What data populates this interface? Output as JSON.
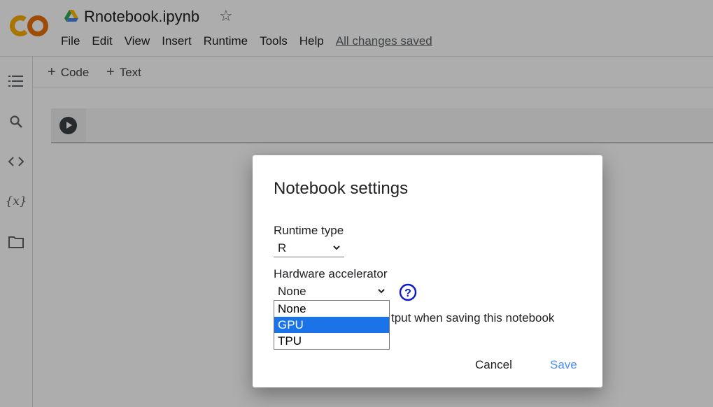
{
  "header": {
    "logo_text": "CO",
    "title": "Rnotebook.ipynb",
    "menu": [
      "File",
      "Edit",
      "View",
      "Insert",
      "Runtime",
      "Tools",
      "Help"
    ],
    "save_status": "All changes saved"
  },
  "sidebar": {
    "items": [
      {
        "icon": "table-of-contents-icon"
      },
      {
        "icon": "search-icon"
      },
      {
        "icon": "code-snippets-icon"
      },
      {
        "icon": "variables-icon",
        "label": "{x}"
      },
      {
        "icon": "files-folder-icon"
      }
    ]
  },
  "toolbar": {
    "add_code": "Code",
    "add_text": "Text"
  },
  "dialog": {
    "title": "Notebook settings",
    "runtime_type_label": "Runtime type",
    "runtime_type_value": "R",
    "hardware_label": "Hardware accelerator",
    "hardware_value": "None",
    "hardware_options": [
      "None",
      "GPU",
      "TPU"
    ],
    "highlighted_option": "GPU",
    "checkbox_text_visible": "tput when saving this notebook",
    "cancel_label": "Cancel",
    "save_label": "Save"
  },
  "colors": {
    "accent": "#1a73e8",
    "save_button": "#4a8ef5",
    "logo_orange": "#f9ab00",
    "logo_dark_orange": "#e8710a"
  }
}
